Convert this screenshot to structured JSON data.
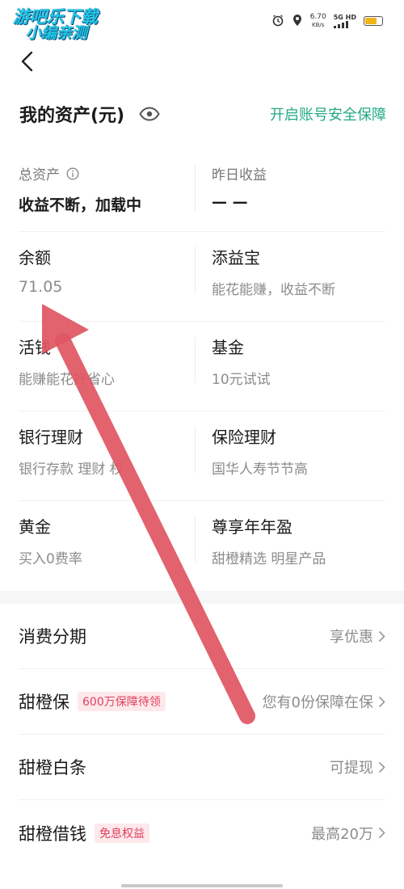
{
  "watermark": {
    "line1": "游吧乐下载",
    "line2": "小编亲测"
  },
  "status_bar": {
    "speed_value": "6.70",
    "speed_unit": "KB/s",
    "network": "5G HD",
    "battery_level": 0.75,
    "battery_color": "#f2b51c"
  },
  "header": {
    "title": "我的资产(元)",
    "security_link": "开启账号安全保障",
    "accent_color": "#23a982"
  },
  "assets": {
    "total_label": "总资产",
    "total_value": "收益不断，加载中",
    "yesterday_label": "昨日收益",
    "yesterday_value": "— —",
    "cells": [
      {
        "title": "余额",
        "sub": "71.05"
      },
      {
        "title": "添益宝",
        "sub": "能花能赚，收益不断"
      },
      {
        "title": "活钱",
        "sub": "能赚能花好省心"
      },
      {
        "title": "基金",
        "sub": "10元试试"
      },
      {
        "title": "银行理财",
        "sub": "银行存款 理财 权"
      },
      {
        "title": "保险理财",
        "sub": "国华人寿节节高"
      },
      {
        "title": "黄金",
        "sub": "买入0费率"
      },
      {
        "title": "尊享年年盈",
        "sub": "甜橙精选 明星产品"
      }
    ]
  },
  "list": [
    {
      "title": "消费分期",
      "tag": "",
      "right": "享优惠"
    },
    {
      "title": "甜橙保",
      "tag": "600万保障待领",
      "right": "您有0份保障在保"
    },
    {
      "title": "甜橙白条",
      "tag": "",
      "right": "可提现"
    },
    {
      "title": "甜橙借钱",
      "tag": "免息权益",
      "right": "最高20万"
    }
  ],
  "colors": {
    "tag_bg": "#fde8ec",
    "tag_text": "#e2405c",
    "annotation_arrow": "#e05562"
  }
}
